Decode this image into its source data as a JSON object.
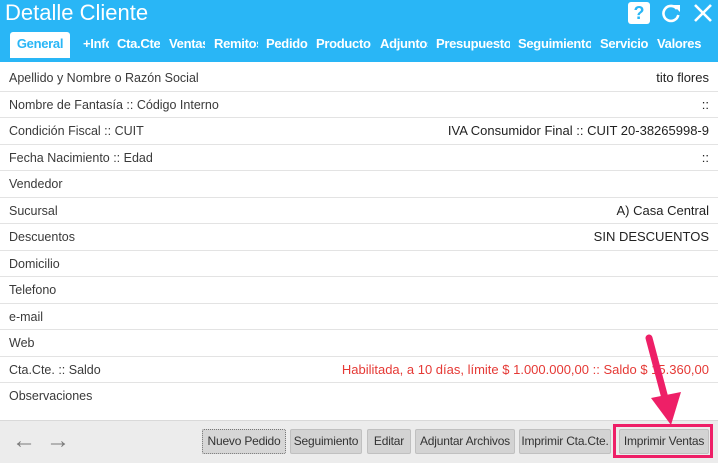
{
  "header": {
    "title": "Detalle Cliente",
    "help_glyph": "?"
  },
  "tabs": [
    {
      "label": "General",
      "active": true
    },
    {
      "label": "+Info"
    },
    {
      "label": "Cta.Cte."
    },
    {
      "label": "Ventas"
    },
    {
      "label": "Remitos"
    },
    {
      "label": "Pedidos"
    },
    {
      "label": "Productos"
    },
    {
      "label": "Adjuntos"
    },
    {
      "label": "Presupuestos"
    },
    {
      "label": "Seguimiento"
    },
    {
      "label": "Servicios"
    },
    {
      "label": "Valores"
    }
  ],
  "fields": [
    {
      "label": "Apellido y Nombre o Razón Social",
      "value": "tito flores"
    },
    {
      "label": "Nombre de Fantasía :: Código Interno",
      "value": "::"
    },
    {
      "label": "Condición Fiscal :: CUIT",
      "value": "IVA Consumidor Final :: CUIT 20-38265998-9"
    },
    {
      "label": "Fecha Nacimiento :: Edad",
      "value": "::"
    },
    {
      "label": "Vendedor",
      "value": ""
    },
    {
      "label": "Sucursal",
      "value": "A) Casa Central"
    },
    {
      "label": "Descuentos",
      "value": "SIN DESCUENTOS"
    },
    {
      "label": "Domicilio",
      "value": ""
    },
    {
      "label": "Telefono",
      "value": ""
    },
    {
      "label": "e-mail",
      "value": ""
    },
    {
      "label": "Web",
      "value": ""
    },
    {
      "label": "Cta.Cte. :: Saldo",
      "value": "Habilitada, a 10 días, límite $ 1.000.000,00 :: Saldo $ 15.360,00"
    },
    {
      "label": "Observaciones",
      "value": ""
    }
  ],
  "footer": {
    "prev_glyph": "←",
    "next_glyph": "→",
    "buttons": [
      "Nuevo Pedido",
      "Seguimiento",
      "Editar",
      "Adjuntar Archivos",
      "Imprimir Cta.Cte.",
      "Imprimir Ventas"
    ]
  },
  "colors": {
    "header_bg": "#29b6f6",
    "alert_text": "#e53935",
    "annotation": "#ee1f67"
  }
}
